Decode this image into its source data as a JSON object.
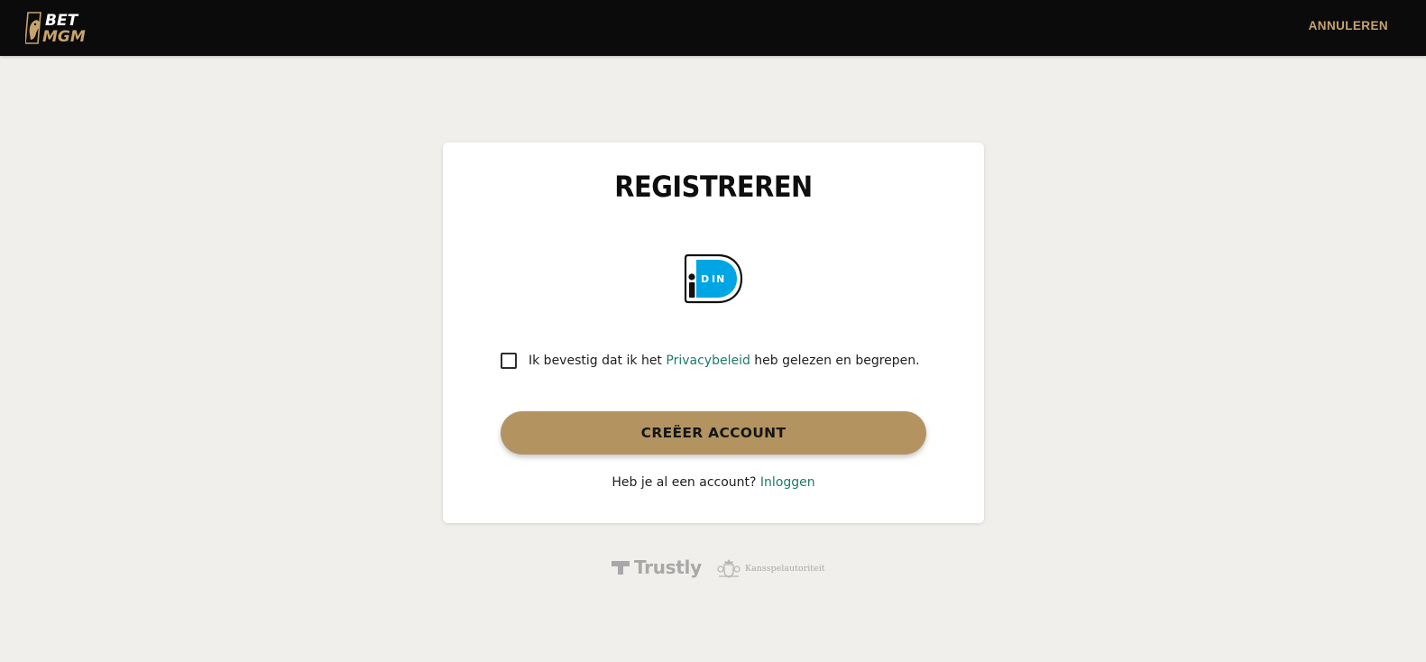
{
  "header": {
    "logo": {
      "top": "BET",
      "bottom": "MGM",
      "icon": "lion-icon"
    },
    "cancel_label": "ANNULEREN"
  },
  "card": {
    "title": "REGISTREREN",
    "idin": {
      "letters": "iDIN",
      "icon": "idin-logo"
    },
    "consent": {
      "checked": false,
      "before": "Ik bevestig dat ik het ",
      "link": "Privacybeleid",
      "after": " heb gelezen en begrepen."
    },
    "create_button_label": "CREËER ACCOUNT",
    "login": {
      "prompt": "Heb je al een account? ",
      "link": "Inloggen"
    }
  },
  "footer": {
    "trustly_label": "Trustly",
    "ksa_label": "Kansspelautoriteit"
  },
  "colors": {
    "header_bg": "#0b0b0b",
    "accent_gold": "#b39461",
    "cancel_gold": "#c6a36e",
    "link_teal": "#1e7a6b",
    "page_bg": "#f1efeb",
    "idin_blue": "#00a5e4"
  }
}
